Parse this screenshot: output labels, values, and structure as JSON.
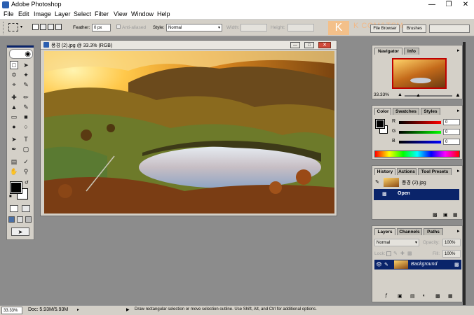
{
  "app": {
    "title": "Adobe Photoshop"
  },
  "menu": [
    "File",
    "Edit",
    "Image",
    "Layer",
    "Select",
    "Filter",
    "View",
    "Window",
    "Help"
  ],
  "options": {
    "feather_label": "Feather:",
    "feather_value": "0 px",
    "antialiased_label": "Anti-aliased",
    "style_label": "Style:",
    "style_value": "Normal",
    "width_label": "Width:",
    "height_label": "Height:",
    "file_browser": "File Browser",
    "brushes": "Brushes",
    "watermark": "K COM&TSM"
  },
  "document": {
    "title": "풍경 (2).jpg @ 33.3% (RGB)"
  },
  "navigator": {
    "tabs": [
      "Navigator",
      "Info"
    ],
    "zoom": "33.33%"
  },
  "color": {
    "tabs": [
      "Color",
      "Swatches",
      "Styles"
    ],
    "channels": [
      {
        "label": "R",
        "value": "0"
      },
      {
        "label": "G",
        "value": "0"
      },
      {
        "label": "B",
        "value": "0"
      }
    ],
    "foreground": "#000000",
    "background": "#ffffff"
  },
  "history": {
    "tabs": [
      "History",
      "Actions",
      "Tool Presets"
    ],
    "snapshot": "풍경 (2).jpg",
    "steps": [
      "Open"
    ]
  },
  "layers": {
    "tabs": [
      "Layers",
      "Channels",
      "Paths"
    ],
    "blend_mode": "Normal",
    "opacity_label": "Opacity:",
    "opacity_value": "100%",
    "lock_label": "Lock:",
    "fill_label": "Fill:",
    "fill_value": "100%",
    "layer_name": "Background"
  },
  "status": {
    "zoom": "33.33%",
    "doc": "Doc: 5.93M/5.93M",
    "hint": "Draw rectangular selection or move selection outline. Use Shift, Alt, and Ctrl for additional options."
  },
  "colors": {
    "accent": "#0a246a",
    "panel": "#d4d0c8",
    "workspace": "#8c8c8c"
  }
}
